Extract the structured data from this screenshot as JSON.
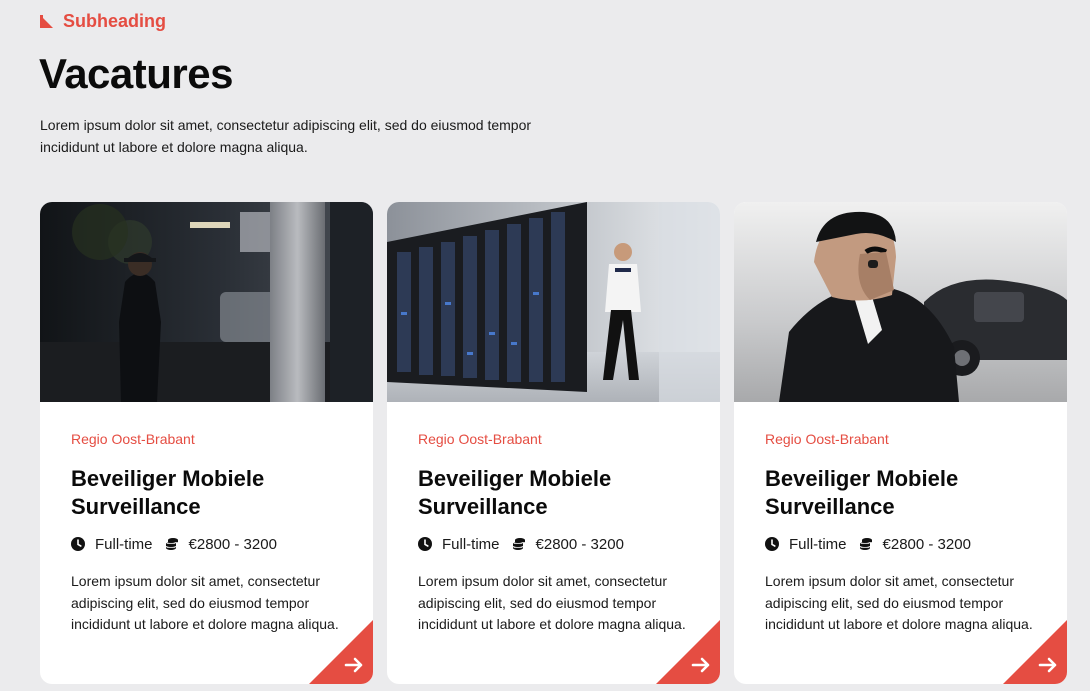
{
  "header": {
    "subheading": "Subheading",
    "title": "Vacatures",
    "intro": "Lorem ipsum dolor sit amet, consectetur adipiscing elit, sed do eiusmod tempor incididunt ut labore et dolore magna aliqua."
  },
  "colors": {
    "accent": "#e54d42",
    "background": "#ebebed",
    "card": "#ffffff"
  },
  "cards": [
    {
      "image": "security-guard-night-photo",
      "region": "Regio Oost-Brabant",
      "title": "Beveiliger Mobiele Surveillance",
      "type": "Full-time",
      "salary": "€2800 - 3200",
      "description": "Lorem ipsum dolor sit amet, consectetur adipiscing elit, sed do eiusmod tempor incididunt ut labore et dolore magna aliqua."
    },
    {
      "image": "datacenter-guard-photo",
      "region": "Regio Oost-Brabant",
      "title": "Beveiliger Mobiele Surveillance",
      "type": "Full-time",
      "salary": "€2800 - 3200",
      "description": "Lorem ipsum dolor sit amet, consectetur adipiscing elit, sed do eiusmod tempor incididunt ut labore et dolore magna aliqua."
    },
    {
      "image": "bodyguard-earpiece-photo",
      "region": "Regio Oost-Brabant",
      "title": "Beveiliger Mobiele Surveillance",
      "type": "Full-time",
      "salary": "€2800 - 3200",
      "description": "Lorem ipsum dolor sit amet, consectetur adipiscing elit, sed do eiusmod tempor incididunt ut labore et dolore magna aliqua."
    }
  ]
}
